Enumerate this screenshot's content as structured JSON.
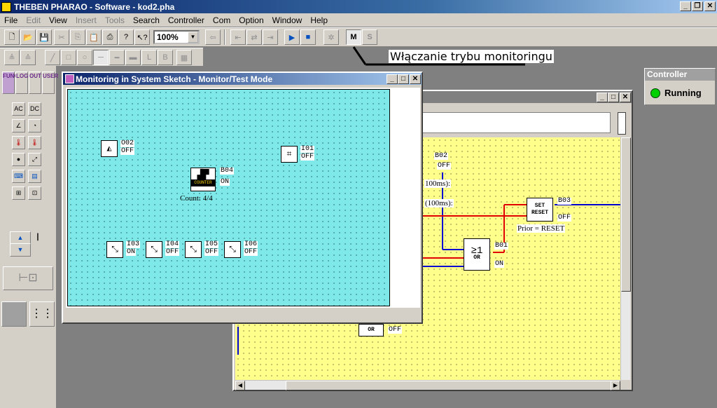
{
  "app": {
    "title": "THEBEN PHARAO - Software - kod2.pha"
  },
  "menu": [
    {
      "label": "File",
      "enabled": true
    },
    {
      "label": "Edit",
      "enabled": false
    },
    {
      "label": "View",
      "enabled": true
    },
    {
      "label": "Insert",
      "enabled": false
    },
    {
      "label": "Tools",
      "enabled": false
    },
    {
      "label": "Search",
      "enabled": true
    },
    {
      "label": "Controller",
      "enabled": true
    },
    {
      "label": "Com",
      "enabled": true
    },
    {
      "label": "Option",
      "enabled": true
    },
    {
      "label": "Window",
      "enabled": true
    },
    {
      "label": "Help",
      "enabled": true
    }
  ],
  "toolbar": {
    "zoom": "100%"
  },
  "annotation": "Włączanie trybu monitoringu",
  "left_tabs": [
    "FUNC",
    "LOGI",
    "OUT",
    "USER"
  ],
  "controller": {
    "header": "Controller",
    "status": "Running",
    "status_color": "#00d000"
  },
  "monitor_window": {
    "title": "Monitoring in System Sketch - Monitor/Test Mode",
    "blocks": [
      {
        "name": "O02",
        "state": "OFF",
        "icon": "lamp-icon"
      },
      {
        "name": "I01",
        "state": "OFF",
        "icon": "input-icon"
      },
      {
        "name": "B04",
        "state": "ON",
        "icon": "counter-icon",
        "label": "COUNTER",
        "extra": "Count: 4/4"
      },
      {
        "name": "I03",
        "state": "ON",
        "icon": "switch-icon"
      },
      {
        "name": "I04",
        "state": "OFF",
        "icon": "switch-icon"
      },
      {
        "name": "I05",
        "state": "OFF",
        "icon": "switch-icon"
      },
      {
        "name": "I06",
        "state": "OFF",
        "icon": "switch-icon"
      }
    ]
  },
  "logic_window": {
    "b02": {
      "name": "B02",
      "state": "OFF",
      "text1": "100ms):",
      "text2": "(100ms):"
    },
    "b01": {
      "name": "B01",
      "state": "ON",
      "sym": "≥1",
      "gate": "OR"
    },
    "b03": {
      "name": "B03",
      "state": "OFF",
      "set": "SET",
      "reset": "RESET",
      "prior": "Prior = RESET"
    },
    "bottom_gate": {
      "gate": "OR",
      "state": "OFF"
    }
  }
}
